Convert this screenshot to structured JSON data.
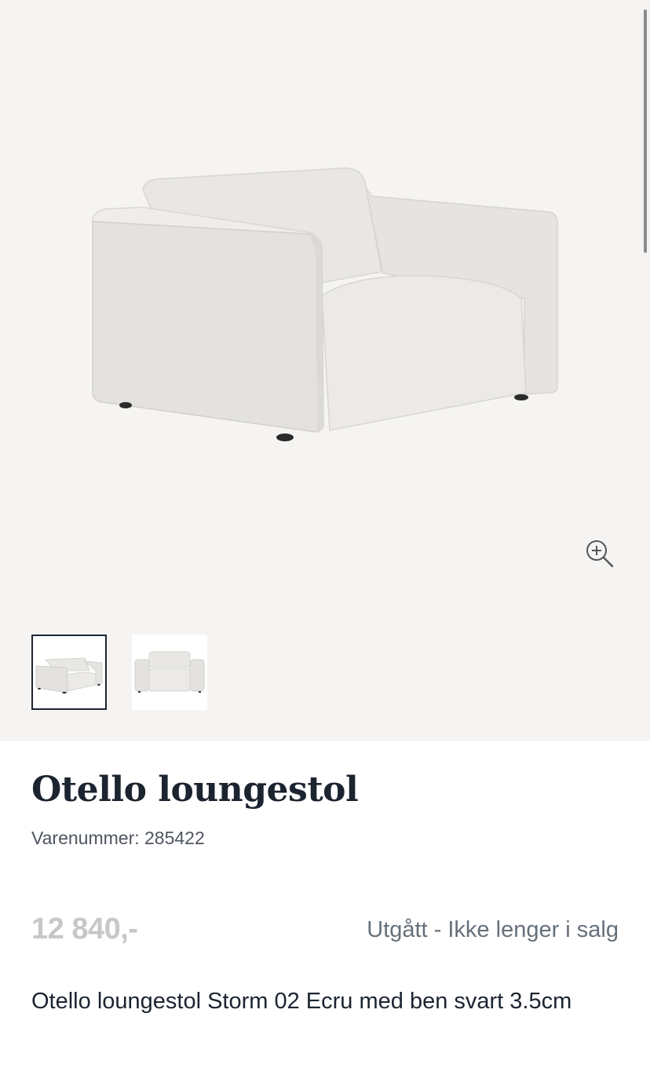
{
  "product": {
    "name": "Otello loungestol",
    "sku_label": "Varenummer:",
    "sku_value": "285422",
    "price": "12 840,-",
    "status": "Utgått - Ikke lenger i salg",
    "description": "Otello loungestol Storm 02 Ecru med ben svart 3.5cm"
  },
  "gallery": {
    "zoom_icon": "zoom-in-icon",
    "thumbnails": [
      {
        "id": "thumb-1",
        "selected": true,
        "view": "angled"
      },
      {
        "id": "thumb-2",
        "selected": false,
        "view": "front"
      }
    ]
  },
  "colors": {
    "gallery_bg": "#f5f4f2",
    "title": "#1c2430",
    "price_muted": "#c7c7c7",
    "status": "#66707a"
  }
}
